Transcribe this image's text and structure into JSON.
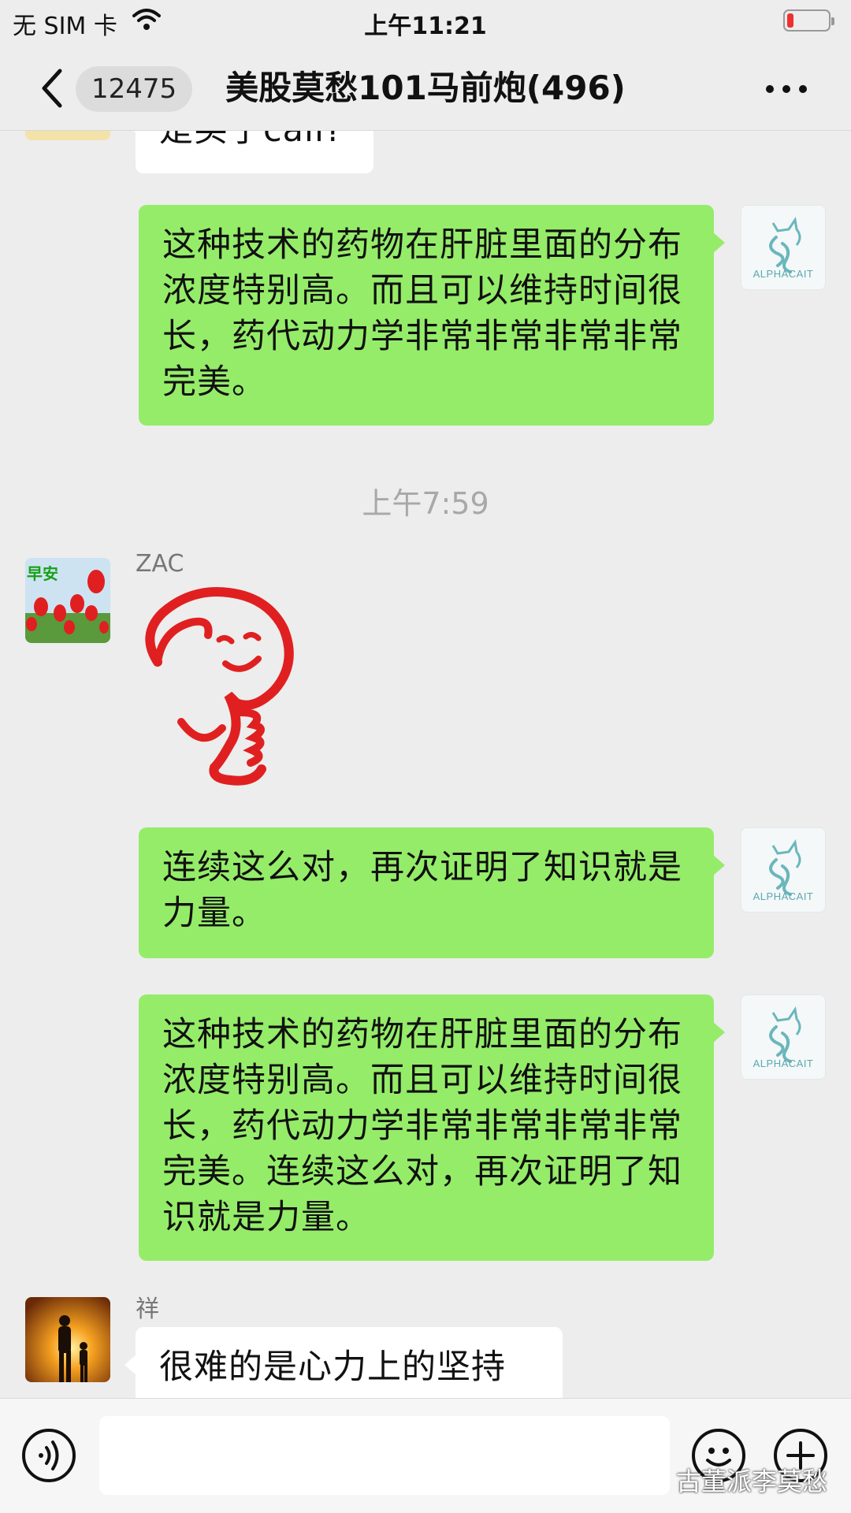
{
  "status_bar": {
    "carrier": "无 SIM 卡",
    "time": "上午11:21",
    "battery_level": 0.15,
    "battery_color": "#ee3030"
  },
  "nav": {
    "back_icon": "chevron-left-icon",
    "unread_count": "12475",
    "title": "美股莫愁101马前炮(496)",
    "more_icon": "more-horizontal-icon"
  },
  "messages": {
    "m0_partial": "是买了call?",
    "m1": "这种技术的药物在肝脏里面的分布浓度特别高。而且可以维持时间很长，药代动力学非常非常非常非常完美。",
    "timestamp": "上午7:59",
    "zac_name": "ZAC",
    "zac_avatar_text": "早安",
    "m3": "连续这么对，再次证明了知识就是力量。",
    "m4": "这种技术的药物在肝脏里面的分布浓度特别高。而且可以维持时间很长，药代动力学非常非常非常非常完美。连续这么对，再次证明了知识就是力量。",
    "xiang_name": "祥",
    "m5": "很难的是心力上的坚持"
  },
  "alphacat_avatar_caption": "ALPHACAIT",
  "input_bar": {
    "voice_icon": "voice-icon",
    "emoji_icon": "emoji-icon",
    "plus_icon": "plus-icon",
    "watermark": "古董派李莫愁"
  },
  "colors": {
    "outgoing_bubble": "#95ec69",
    "incoming_bubble": "#ffffff",
    "background": "#ededed"
  }
}
